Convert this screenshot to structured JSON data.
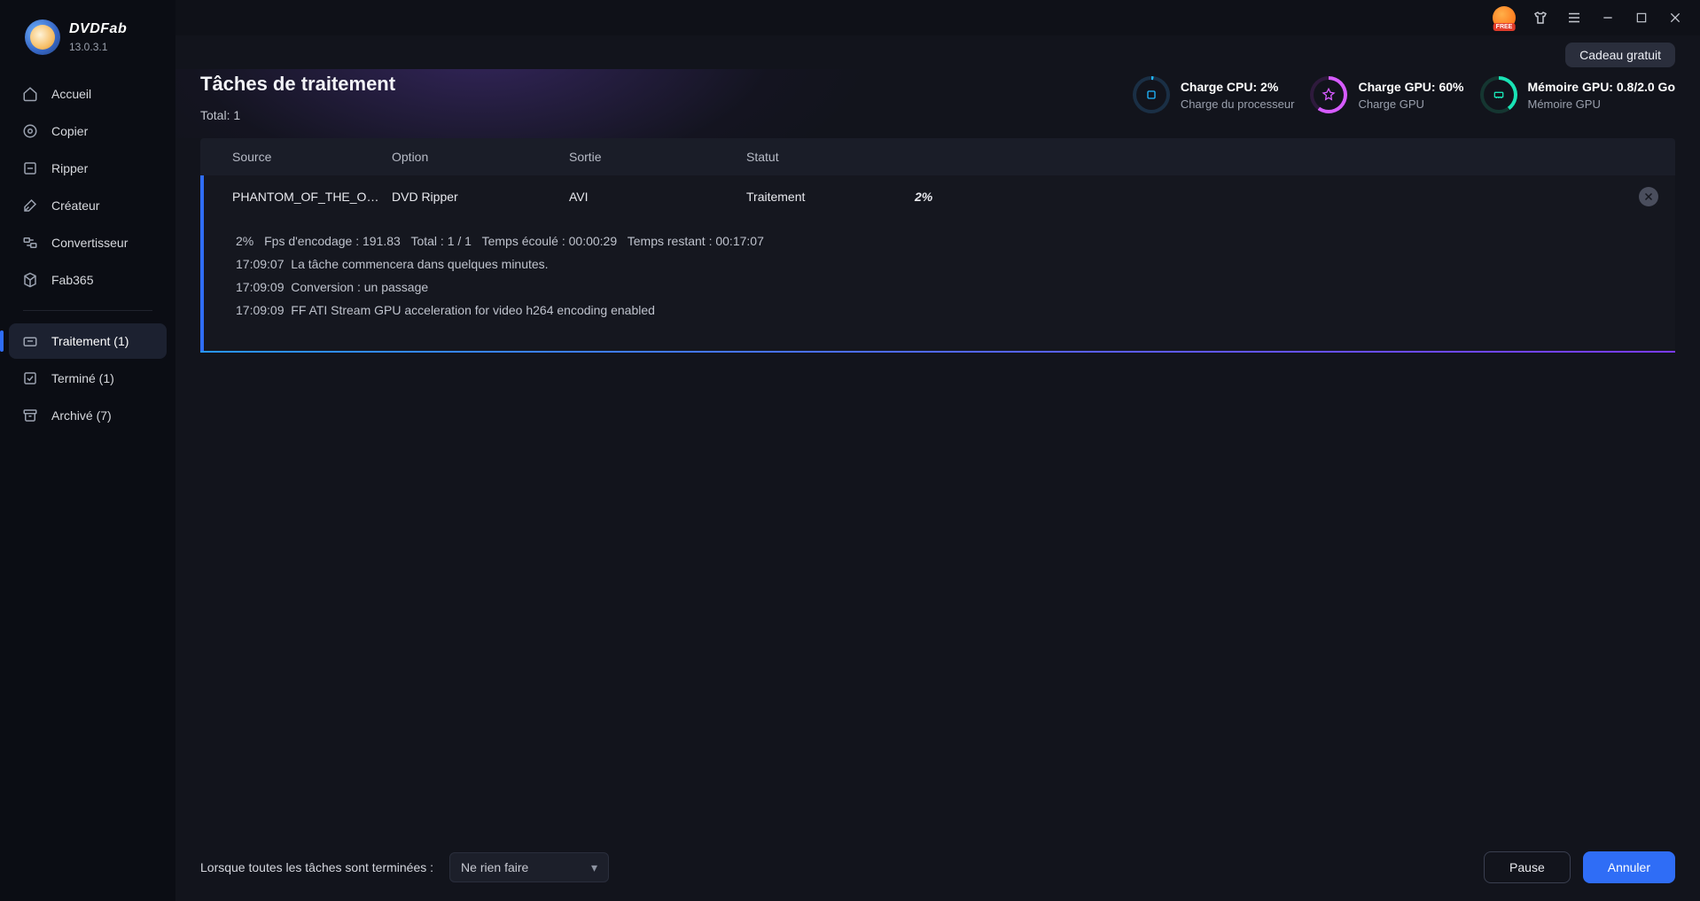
{
  "brand": {
    "name_a": "DVD",
    "name_b": "Fab",
    "version": "13.0.3.1"
  },
  "titlebar": {
    "promo": "Cadeau gratuit"
  },
  "sidebar": {
    "items": [
      {
        "label": "Accueil",
        "icon": "home"
      },
      {
        "label": "Copier",
        "icon": "copy"
      },
      {
        "label": "Ripper",
        "icon": "disc"
      },
      {
        "label": "Créateur",
        "icon": "wand"
      },
      {
        "label": "Convertisseur",
        "icon": "convert"
      },
      {
        "label": "Fab365",
        "icon": "cube"
      }
    ],
    "status_items": [
      {
        "label": "Traitement (1)",
        "icon": "processing",
        "active": true
      },
      {
        "label": "Terminé (1)",
        "icon": "done"
      },
      {
        "label": "Archivé (7)",
        "icon": "archive"
      }
    ]
  },
  "page": {
    "title": "Tâches de traitement",
    "total_label": "Total: 1"
  },
  "stats": {
    "cpu": {
      "title": "Charge CPU: 2%",
      "sub": "Charge du processeur"
    },
    "gpu": {
      "title": "Charge GPU: 60%",
      "sub": "Charge GPU"
    },
    "mem": {
      "title": "Mémoire GPU: 0.8/2.0 Go",
      "sub": "Mémoire GPU"
    }
  },
  "columns": {
    "source": "Source",
    "option": "Option",
    "sortie": "Sortie",
    "statut": "Statut"
  },
  "task": {
    "source": "PHANTOM_OF_THE_OPE...",
    "option": "DVD Ripper",
    "sortie": "AVI",
    "statut": "Traitement",
    "progress": "2%",
    "summary": {
      "pct": "2%",
      "fps": "Fps d'encodage : 191.83",
      "total": "Total : 1 / 1",
      "elapsed": "Temps écoulé : 00:00:29",
      "remaining": "Temps restant : 00:17:07"
    },
    "log": [
      {
        "time": "17:09:07",
        "msg": "La tâche commencera dans quelques minutes."
      },
      {
        "time": "17:09:09",
        "msg": "Conversion : un passage"
      },
      {
        "time": "17:09:09",
        "msg": "FF ATI Stream GPU acceleration for video h264 encoding enabled"
      }
    ]
  },
  "footer": {
    "label": "Lorsque toutes les tâches sont terminées :",
    "select_value": "Ne rien faire",
    "pause": "Pause",
    "cancel": "Annuler"
  }
}
